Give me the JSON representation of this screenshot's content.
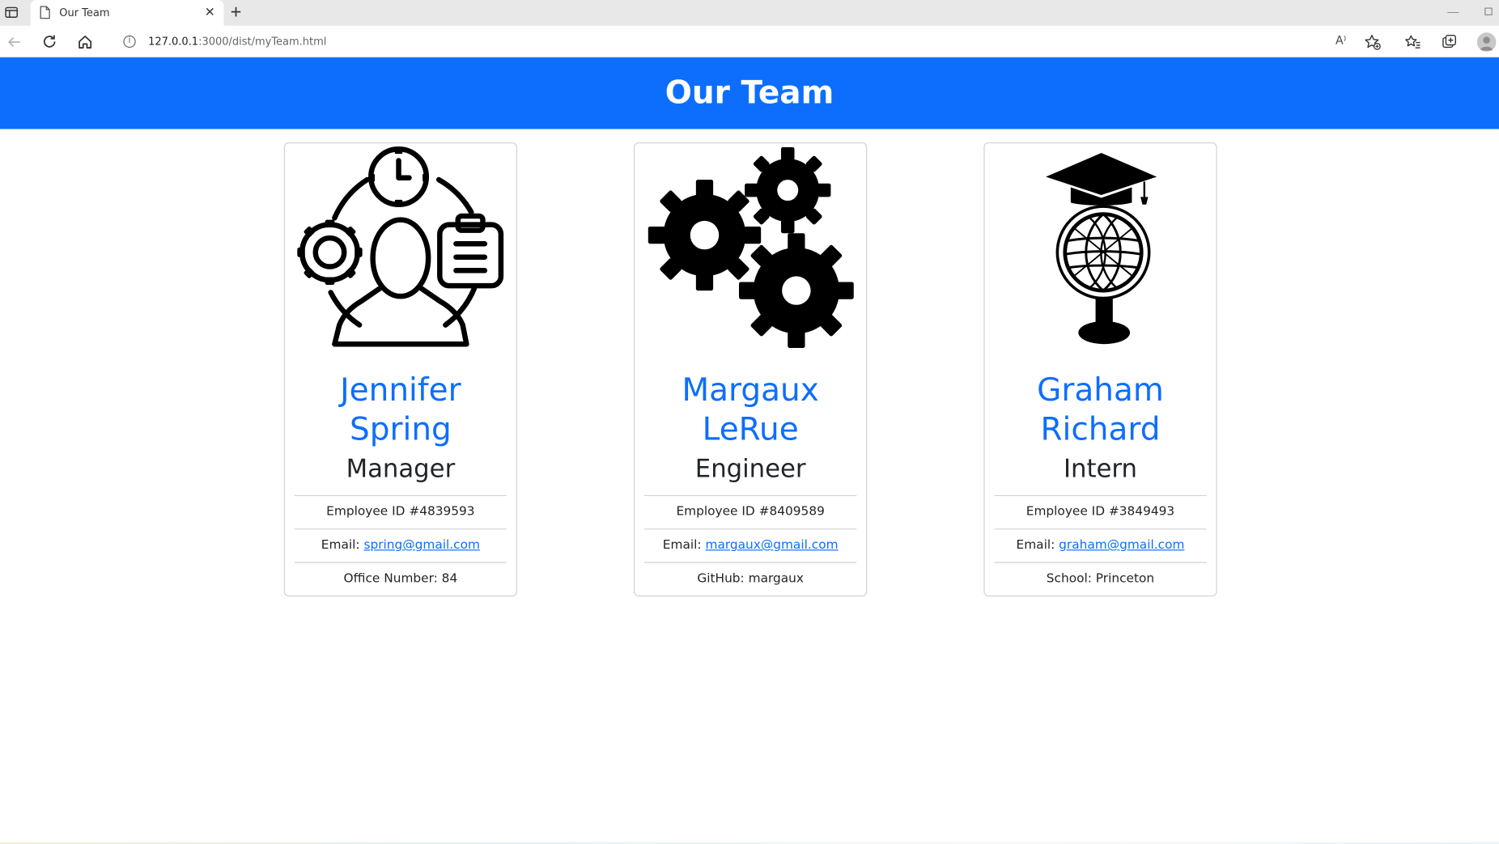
{
  "browser": {
    "tab_title": "Our Team",
    "url_host": "127.0.0.1",
    "url_rest": ":3000/dist/myTeam.html",
    "read_aloud": "A⁾"
  },
  "page": {
    "heading": "Our Team",
    "accent_color": "#0d6efd"
  },
  "cards": [
    {
      "icon": "manager-icon",
      "name_line1": "Jennifer",
      "name_line2": "Spring",
      "role": "Manager",
      "id_text": "Employee ID #4839593",
      "email_label": "Email: ",
      "email": "spring@gmail.com",
      "extra": "Office Number: 84"
    },
    {
      "icon": "gears-icon",
      "name_line1": "Margaux",
      "name_line2": "LeRue",
      "role": "Engineer",
      "id_text": "Employee ID #8409589",
      "email_label": "Email: ",
      "email": "margaux@gmail.com",
      "extra": "GitHub: margaux"
    },
    {
      "icon": "graduate-globe-icon",
      "name_line1": "Graham",
      "name_line2": "Richard",
      "role": "Intern",
      "id_text": "Employee ID #3849493",
      "email_label": "Email: ",
      "email": "graham@gmail.com",
      "extra": "School: Princeton"
    }
  ]
}
